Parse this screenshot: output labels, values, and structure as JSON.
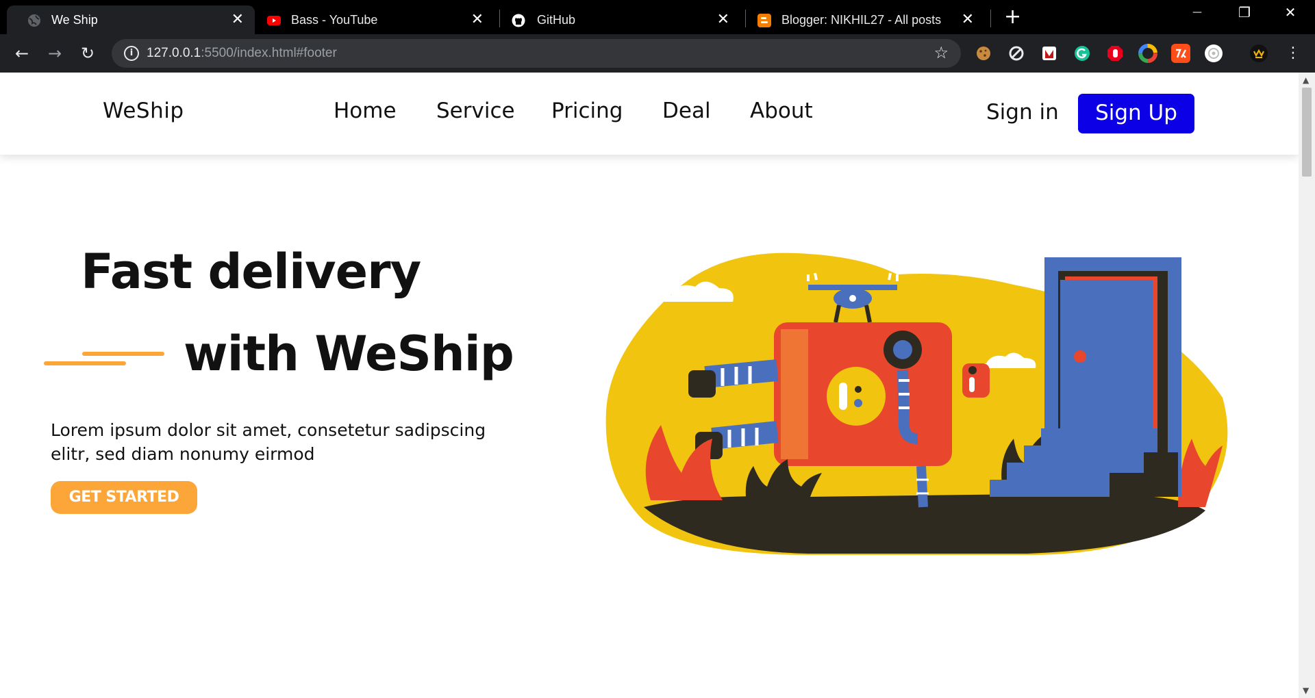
{
  "browser": {
    "tabs": [
      {
        "title": "We Ship",
        "active": true,
        "icon": "globe-icon"
      },
      {
        "title": "Bass - YouTube",
        "active": false,
        "icon": "youtube-icon"
      },
      {
        "title": "GitHub",
        "active": false,
        "icon": "github-icon"
      },
      {
        "title": "Blogger: NIKHIL27 - All posts",
        "active": false,
        "icon": "blogger-icon"
      }
    ],
    "url_host": "127.0.0.1",
    "url_rest": ":5500/index.html#footer",
    "close_glyph": "✕",
    "newtab_glyph": "+",
    "back_glyph": "←",
    "forward_glyph": "→",
    "reload_glyph": "↻",
    "star_glyph": "☆",
    "menu_glyph": "⋮",
    "minimize_glyph": "—",
    "maximize_glyph": "❐"
  },
  "site": {
    "brand": "WeShip",
    "nav": [
      "Home",
      "Service",
      "Pricing",
      "Deal",
      "About"
    ],
    "signin": "Sign in",
    "signup": "Sign Up",
    "hero_line1": "Fast delivery",
    "hero_line2": "with WeShip",
    "lead": "Lorem ipsum dolor sit amet, consetetur sadipscing elitr, sed diam nonumy eirmod",
    "cta": "GET STARTED"
  },
  "colors": {
    "accent_orange": "#fca639",
    "signup_blue": "#0b00e6",
    "illus_yellow": "#f1c40f",
    "illus_red": "#e8472e",
    "illus_blue": "#4a6fbd",
    "illus_dark": "#2f2a1f"
  }
}
